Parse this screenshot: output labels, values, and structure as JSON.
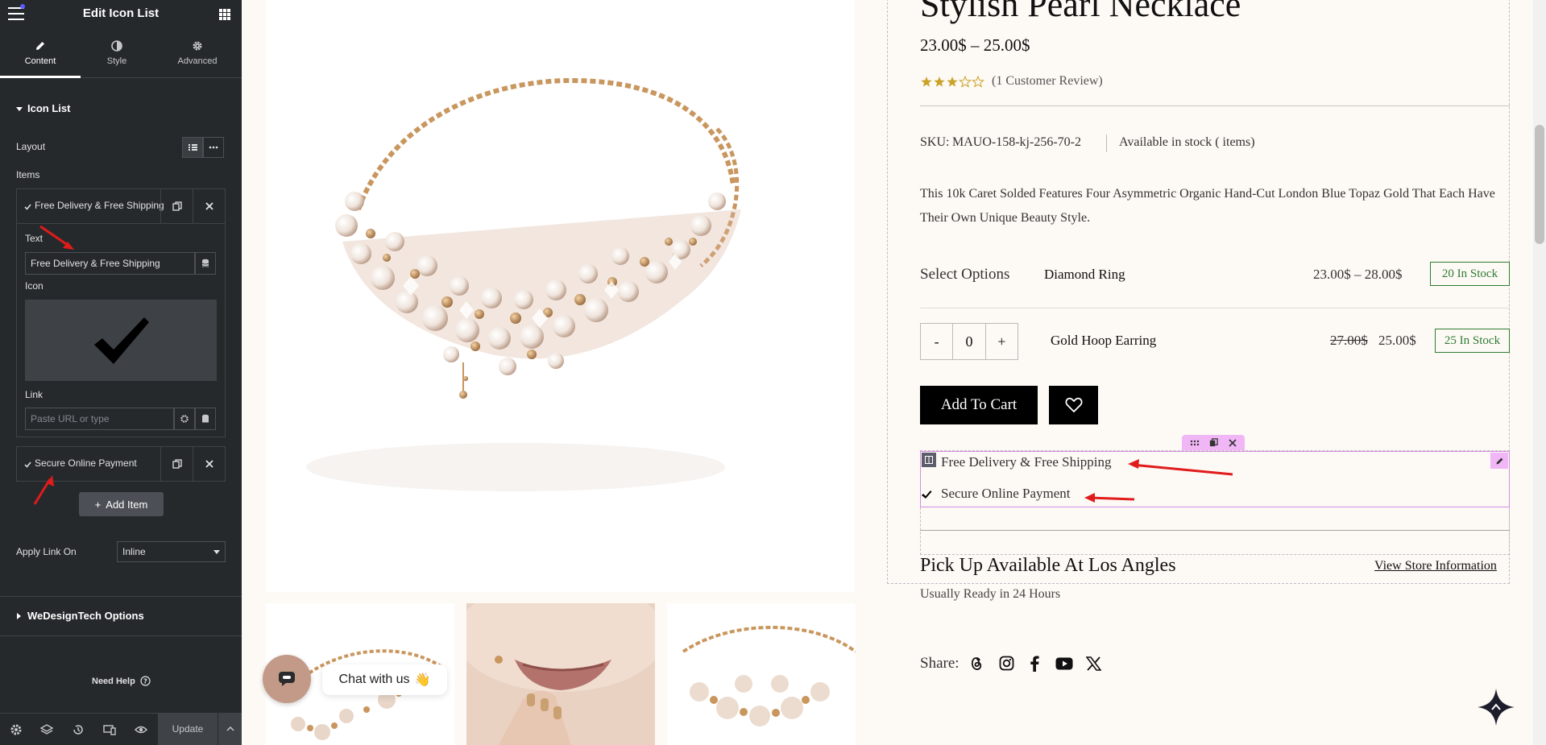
{
  "editor": {
    "title": "Edit Icon List",
    "tabs": [
      {
        "label": "Content",
        "icon": "pencil-icon"
      },
      {
        "label": "Style",
        "icon": "half-circle-icon"
      },
      {
        "label": "Advanced",
        "icon": "gear-icon"
      }
    ],
    "section_title": "Icon List",
    "layout_label": "Layout",
    "items_label": "Items",
    "items": [
      {
        "title": "Free Delivery & Free Shipping"
      },
      {
        "title": "Secure Online Payment"
      }
    ],
    "text_label": "Text",
    "text_value": "Free Delivery & Free Shipping",
    "icon_label": "Icon",
    "link_label": "Link",
    "link_placeholder": "Paste URL or type",
    "add_item_label": "Add Item",
    "apply_link_label": "Apply Link On",
    "apply_link_value": "Inline",
    "wedesign_label": "WeDesignTech Options",
    "need_help": "Need Help",
    "update_label": "Update"
  },
  "product": {
    "title": "Stylish Pearl Necklace",
    "price": "23.00$ – 25.00$",
    "rating": 3,
    "rating_max": 5,
    "review_text": "(1 Customer Review)",
    "sku_label": "SKU:",
    "sku_value": "MAUO-158-kj-256-70-2",
    "stock_text": "Available in stock ( items)",
    "description": "This 10k Caret Solded Features Four Asymmetric Organic Hand-Cut London Blue Topaz Gold That Each Have Their Own Unique Beauty Style.",
    "select_options_label": "Select Options",
    "option1": {
      "name": "Diamond Ring",
      "price": "23.00$ – 28.00$",
      "stock": "20 In Stock"
    },
    "option2": {
      "name": "Gold Hoop Earring",
      "old_price": "27.00$",
      "price": "25.00$",
      "stock": "25 In Stock"
    },
    "qty": {
      "minus": "-",
      "value": "0",
      "plus": "+"
    },
    "add_to_cart": "Add To Cart",
    "icon_list": [
      {
        "text": "Free Delivery & Free Shipping"
      },
      {
        "text": "Secure Online Payment"
      }
    ],
    "pickup_title": "Pick Up Available At Los Angles",
    "store_link": "View Store Information",
    "ready_text": "Usually Ready in 24 Hours",
    "share_label": "Share:",
    "share_icons": [
      "threads-icon",
      "instagram-icon",
      "facebook-icon",
      "youtube-icon",
      "x-icon"
    ]
  },
  "chat": {
    "label": "Chat with us",
    "emoji": "👋"
  },
  "colors": {
    "panel_bg": "#26292c",
    "accent": "#f0b6f6",
    "stock_green": "#2e7d32",
    "arrow_red": "#e01b1b"
  }
}
